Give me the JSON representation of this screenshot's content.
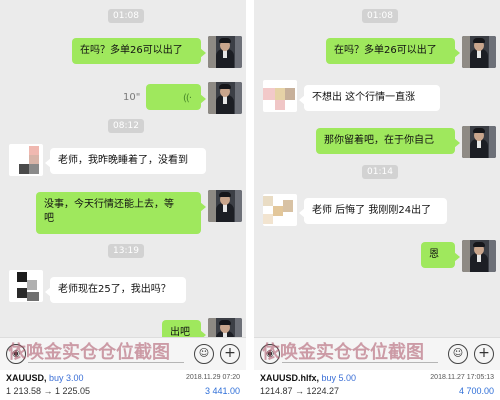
{
  "left": {
    "times": [
      "01:08",
      "08:12",
      "13:19"
    ],
    "messages": [
      {
        "side": "right",
        "text": "在吗？多单26可以出了"
      },
      {
        "side": "right",
        "type": "voice",
        "duration": "10\""
      },
      {
        "side": "left",
        "text": "老师，我昨晚睡着了，没看到"
      },
      {
        "side": "right",
        "text_line1": "没事，今天行情还能上去，等",
        "text_line2": "吧"
      },
      {
        "side": "left",
        "text": "老师现在25了，我出吗？"
      },
      {
        "side": "right",
        "text": "出吧"
      }
    ],
    "watermark": "依唤金实仓仓位截图",
    "trade": {
      "symbol": "XAUUSD,",
      "action": "buy 3.00",
      "datetime": "2018.11.29 07:20",
      "prices": "1 213.58 → 1 225.05",
      "profit": "3 441.00"
    }
  },
  "right": {
    "times": [
      "01:08",
      "01:14"
    ],
    "messages": [
      {
        "side": "right",
        "text": "在吗？多单26可以出了"
      },
      {
        "side": "left",
        "text": "不想出 这个行情一直涨"
      },
      {
        "side": "right",
        "text": "那你留着吧，在于你自己"
      },
      {
        "side": "left",
        "text": "老师 后悔了 我刚刚24出了"
      },
      {
        "side": "right",
        "text": "恩"
      }
    ],
    "watermark": "依唤金实仓仓位截图",
    "trade": {
      "symbol": "XAUUSD.hlfx,",
      "action": "buy 5.00",
      "datetime": "2018.11.27 17:05:13",
      "prices": "1214.87 → 1224.27",
      "profit": "4 700.00"
    }
  },
  "icons": {
    "voice": "voice-wave-icon",
    "mic": "mic-icon",
    "emoji": "emoji-icon",
    "plus": "plus-icon"
  },
  "colors": {
    "chat_bg": "#ebebeb",
    "outgoing_bubble": "#9fe85d",
    "incoming_bubble": "#ffffff",
    "time_badge": "#d2d2d2",
    "buy_action": "#3b6fd6",
    "profit": "#2f6fd8",
    "watermark": "#aa5064"
  }
}
